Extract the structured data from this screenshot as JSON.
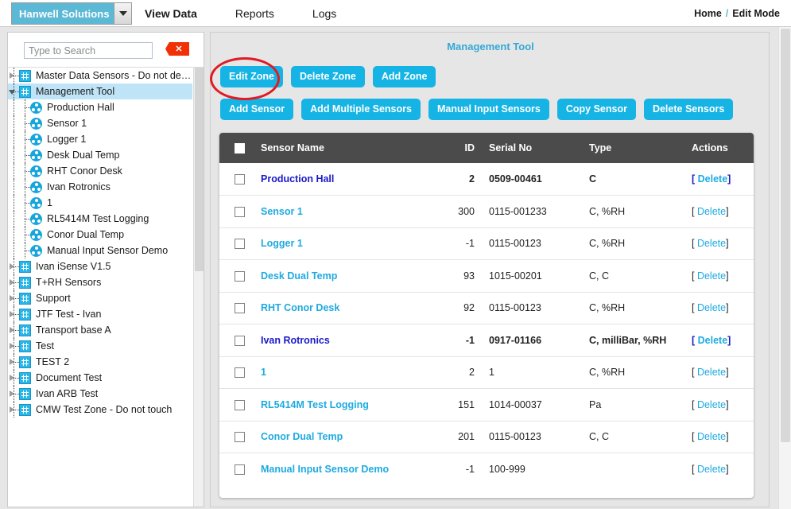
{
  "topbar": {
    "brand": "Hanwell Solutions",
    "brand_dropdown_icon": "chevron-down-icon",
    "tabs": [
      {
        "label": "View Data",
        "active": true
      },
      {
        "label": "Reports",
        "active": false
      },
      {
        "label": "Logs",
        "active": false
      }
    ],
    "breadcrumb": {
      "home": "Home",
      "separator": "/",
      "current": "Edit Mode"
    }
  },
  "sidebar": {
    "search": {
      "placeholder": "Type to Search",
      "value": "",
      "clear_icon": "close-icon"
    },
    "tree": [
      {
        "label": "Master Data Sensors - Do not de…",
        "type": "zone",
        "depth": 0,
        "expanded": false,
        "selected": false
      },
      {
        "label": "Management Tool",
        "type": "zone",
        "depth": 0,
        "expanded": true,
        "selected": true
      },
      {
        "label": "Production Hall",
        "type": "sensor",
        "depth": 1,
        "selected": false
      },
      {
        "label": "Sensor 1",
        "type": "sensor",
        "depth": 1,
        "selected": false
      },
      {
        "label": "Logger 1",
        "type": "sensor",
        "depth": 1,
        "selected": false
      },
      {
        "label": "Desk Dual Temp",
        "type": "sensor",
        "depth": 1,
        "selected": false
      },
      {
        "label": "RHT Conor Desk",
        "type": "sensor",
        "depth": 1,
        "selected": false
      },
      {
        "label": "Ivan Rotronics",
        "type": "sensor",
        "depth": 1,
        "selected": false
      },
      {
        "label": "1",
        "type": "sensor",
        "depth": 1,
        "selected": false
      },
      {
        "label": "RL5414M Test Logging",
        "type": "sensor",
        "depth": 1,
        "selected": false
      },
      {
        "label": "Conor Dual Temp",
        "type": "sensor",
        "depth": 1,
        "selected": false
      },
      {
        "label": "Manual Input Sensor Demo",
        "type": "sensor",
        "depth": 1,
        "selected": false
      },
      {
        "label": "Ivan iSense V1.5",
        "type": "zone",
        "depth": 0,
        "expanded": false,
        "selected": false
      },
      {
        "label": "T+RH Sensors",
        "type": "zone",
        "depth": 0,
        "expanded": false,
        "selected": false
      },
      {
        "label": "Support",
        "type": "zone",
        "depth": 0,
        "expanded": false,
        "selected": false
      },
      {
        "label": "JTF Test - Ivan",
        "type": "zone",
        "depth": 0,
        "expanded": false,
        "selected": false
      },
      {
        "label": "Transport base A",
        "type": "zone",
        "depth": 0,
        "expanded": false,
        "selected": false
      },
      {
        "label": "Test",
        "type": "zone",
        "depth": 0,
        "expanded": false,
        "selected": false
      },
      {
        "label": "TEST 2",
        "type": "zone",
        "depth": 0,
        "expanded": false,
        "selected": false
      },
      {
        "label": "Document Test",
        "type": "zone",
        "depth": 0,
        "expanded": false,
        "selected": false
      },
      {
        "label": "Ivan ARB Test",
        "type": "zone",
        "depth": 0,
        "expanded": false,
        "selected": false
      },
      {
        "label": "CMW Test Zone - Do not touch",
        "type": "zone",
        "depth": 0,
        "expanded": false,
        "selected": false
      }
    ]
  },
  "main": {
    "title": "Management Tool",
    "zone_buttons": [
      {
        "label": "Edit Zone",
        "highlighted": true
      },
      {
        "label": "Delete Zone",
        "highlighted": false
      },
      {
        "label": "Add Zone",
        "highlighted": false
      }
    ],
    "sensor_buttons": [
      {
        "label": "Add Sensor"
      },
      {
        "label": "Add Multiple Sensors"
      },
      {
        "label": "Manual Input Sensors"
      },
      {
        "label": "Copy Sensor"
      },
      {
        "label": "Delete Sensors"
      }
    ],
    "table": {
      "columns": [
        "",
        "Sensor Name",
        "ID",
        "Serial No",
        "Type",
        "Actions"
      ],
      "delete_label": "Delete",
      "bracket_open": "[",
      "bracket_close": "]",
      "rows": [
        {
          "name": "Production Hall",
          "id": "2",
          "serial": "0509-00461",
          "type": "C",
          "checked": false,
          "style": "blue"
        },
        {
          "name": "Sensor 1",
          "id": "300",
          "serial": "0115-001233",
          "type": "C, %RH",
          "checked": false,
          "style": "normal"
        },
        {
          "name": "Logger 1",
          "id": "-1",
          "serial": "0115-00123",
          "type": "C, %RH",
          "checked": false,
          "style": "normal"
        },
        {
          "name": "Desk Dual Temp",
          "id": "93",
          "serial": "1015-00201",
          "type": "C, C",
          "checked": false,
          "style": "normal"
        },
        {
          "name": "RHT Conor Desk",
          "id": "92",
          "serial": "0115-00123",
          "type": "C, %RH",
          "checked": false,
          "style": "normal"
        },
        {
          "name": "Ivan Rotronics",
          "id": "-1",
          "serial": "0917-01166",
          "type": "C, milliBar, %RH",
          "checked": false,
          "style": "blue"
        },
        {
          "name": "1",
          "id": "2",
          "serial": "1",
          "type": "C, %RH",
          "checked": false,
          "style": "normal"
        },
        {
          "name": "RL5414M Test Logging",
          "id": "151",
          "serial": "1014-00037",
          "type": "Pa",
          "checked": false,
          "style": "normal"
        },
        {
          "name": "Conor Dual Temp",
          "id": "201",
          "serial": "0115-00123",
          "type": "C, C",
          "checked": false,
          "style": "normal"
        },
        {
          "name": "Manual Input Sensor Demo",
          "id": "-1",
          "serial": "100-999",
          "type": "",
          "checked": false,
          "style": "normal"
        }
      ]
    }
  },
  "annotation": {
    "shape": "ellipse",
    "color": "#e01b24",
    "targets": "Edit Zone"
  },
  "colors": {
    "accent_cyan": "#16b4e4",
    "brand_blue": "#5cb9d6",
    "table_header": "#4b4b4b",
    "link_blue": "#1eaae0",
    "row_blue": "#1a19c8",
    "highlight_red": "#e01b24",
    "selected_node": "#bfe4f7"
  }
}
